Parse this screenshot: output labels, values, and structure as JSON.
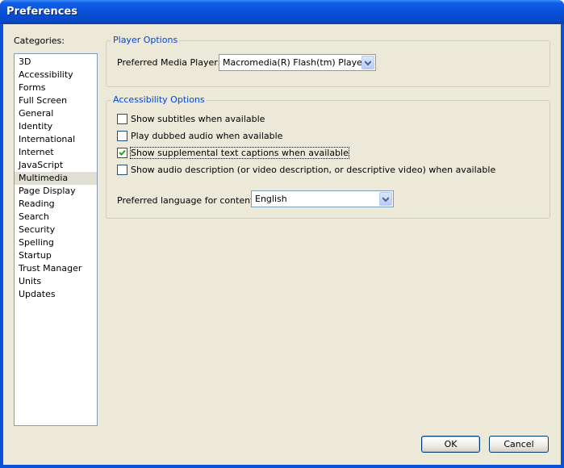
{
  "window": {
    "title": "Preferences"
  },
  "categories": {
    "label": "Categories:",
    "items": [
      "3D",
      "Accessibility",
      "Forms",
      "Full Screen",
      "General",
      "Identity",
      "International",
      "Internet",
      "JavaScript",
      "Multimedia",
      "Page Display",
      "Reading",
      "Search",
      "Security",
      "Spelling",
      "Startup",
      "Trust Manager",
      "Units",
      "Updates"
    ],
    "selected": "Multimedia"
  },
  "player_options": {
    "title": "Player Options",
    "media_player_label": "Preferred Media Player:",
    "media_player_value": "Macromedia(R) Flash(tm) Player"
  },
  "accessibility_options": {
    "title": "Accessibility Options",
    "checkboxes": [
      {
        "label": "Show subtitles when available",
        "checked": false
      },
      {
        "label": "Play dubbed audio when available",
        "checked": false
      },
      {
        "label": "Show supplemental text captions when available",
        "checked": true
      },
      {
        "label": "Show audio description (or video description, or descriptive video) when available",
        "checked": false
      }
    ],
    "language_label": "Preferred language for content:",
    "language_value": "English"
  },
  "buttons": {
    "ok": "OK",
    "cancel": "Cancel"
  }
}
